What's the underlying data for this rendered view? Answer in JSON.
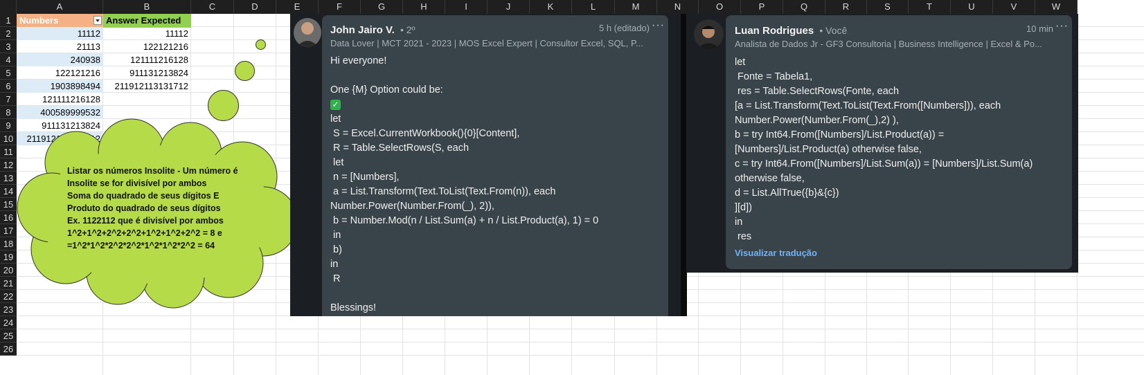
{
  "columns": [
    "A",
    "B",
    "C",
    "D",
    "E",
    "F",
    "G",
    "H",
    "I",
    "J",
    "K",
    "L",
    "M",
    "N",
    "O",
    "P",
    "Q",
    "R",
    "S",
    "T",
    "U",
    "V",
    "W"
  ],
  "rows": [
    "1",
    "2",
    "3",
    "4",
    "5",
    "6",
    "7",
    "8",
    "9",
    "10",
    "11",
    "12",
    "13",
    "14",
    "15",
    "16",
    "17",
    "18",
    "19",
    "20",
    "21",
    "22",
    "23",
    "24",
    "25",
    "26"
  ],
  "sheet": {
    "header_a": "Numbers",
    "header_b": "Answer Expected",
    "col_a": [
      "11112",
      "21113",
      "240938",
      "122121216",
      "1903898494",
      "121111216128",
      "400589999532",
      "911131213824",
      "211912113131712"
    ],
    "col_b": [
      "11112",
      "122121216",
      "121111216128",
      "911131213824",
      "211912113131712"
    ]
  },
  "cloud": {
    "lines": [
      "Listar os números Insolite - Um número é",
      "Insolite se for divisível por ambos",
      "Soma do quadrado de seus dígitos E",
      "Produto do quadrado de seus dígitos",
      "Ex. 1122112 que é divisível por ambos",
      "1^2+1^2+2^2+2^2+1^2+1^2+2^2 = 8 e",
      "=1^2*1^2*2^2*2^2*1^2*1^2*2^2 = 64"
    ]
  },
  "post1": {
    "name": "John Jairo V.",
    "degree": "• 2º",
    "subtitle": "Data Lover | MCT 2021 - 2023 | MOS Excel Expert | Consultor Excel, SQL, P...",
    "time": "5 h (editado)",
    "more": "···",
    "body": "Hi everyone!\n\nOne {M} Option could be:\n\nlet\n S = Excel.CurrentWorkbook(){0}[Content],\n R = Table.SelectRows(S, each\n let\n n = [Numbers],\n a = List.Transform(Text.ToList(Text.From(n)), each\nNumber.Power(Number.From(_), 2)),\n b = Number.Mod(n / List.Sum(a) + n / List.Product(a), 1) = 0\n in\n b)\nin\n R\n\nBlessings!",
    "check": "✓"
  },
  "post2": {
    "name": "Luan Rodrigues",
    "degree": "• Você",
    "subtitle": "Analista de Dados Jr - GF3 Consultoria | Business Intelligence | Excel & Po...",
    "time": "10 min",
    "more": "···",
    "body": "let\n Fonte = Tabela1,\n res = Table.SelectRows(Fonte, each\n[a = List.Transform(Text.ToList(Text.From([Numbers])), each\nNumber.Power(Number.From(_),2) ),\nb = try Int64.From([Numbers]/List.Product(a)) =\n[Numbers]/List.Product(a) otherwise false,\nc = try Int64.From([Numbers]/List.Sum(a)) = [Numbers]/List.Sum(a)\notherwise false,\nd = List.AllTrue({b}&{c})\n][d])\nin\n res",
    "translate": "Visualizar tradução"
  },
  "colors": {
    "header_a": "#f4b183",
    "header_b": "#92d050",
    "band": "#ddebf7",
    "cloud": "#b5dc48",
    "card": "#38434a",
    "link": "#70b5f9"
  }
}
